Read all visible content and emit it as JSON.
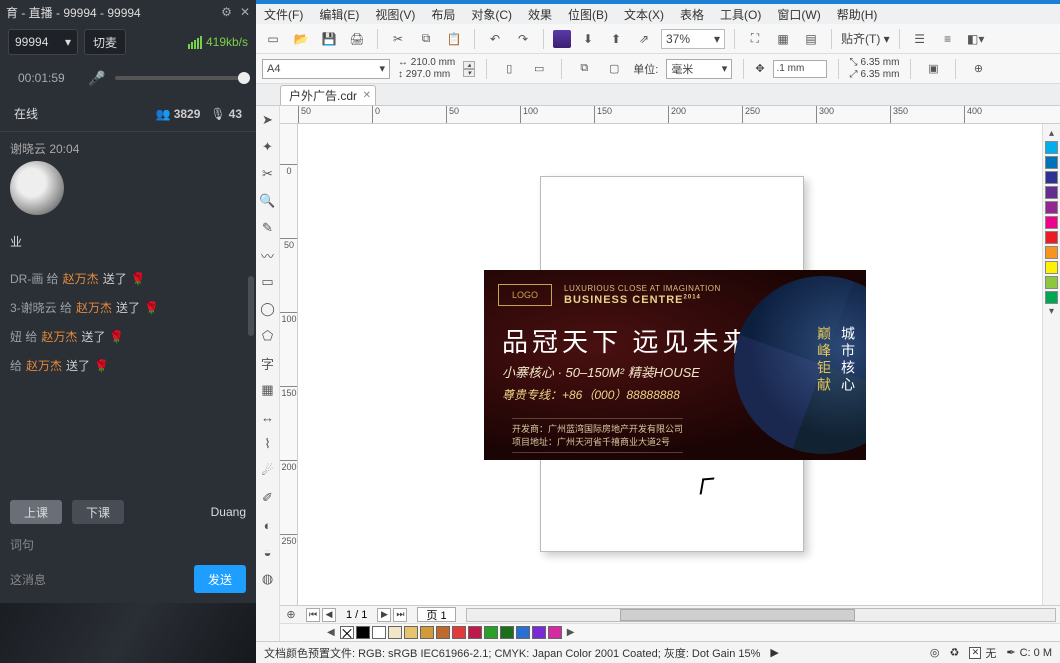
{
  "stream": {
    "title": "育 - 直播 - 99994 - 99994",
    "room_id": "99994",
    "switch_mic": "切麦",
    "bitrate": "419kb/s",
    "elapsed": "00:01:59",
    "tab_online": "在线",
    "viewers": "3829",
    "mics": "43",
    "chat_user": "谢晓云 20:04",
    "biz_label": "业",
    "gifts": [
      {
        "prefix": "DR-画 给",
        "name": "赵万杰",
        "verb": "送了"
      },
      {
        "prefix": "3-谢晓云 给",
        "name": "赵万杰",
        "verb": "送了"
      },
      {
        "prefix": "妞 给",
        "name": "赵万杰",
        "verb": "送了"
      },
      {
        "prefix": "给",
        "name": "赵万杰",
        "verb": "送了"
      }
    ],
    "btn_start": "上课",
    "btn_end": "下课",
    "btn_duang": "Duang",
    "keyword": "词句",
    "input_placeholder": "这消息",
    "send": "发送"
  },
  "menus": [
    "文件(F)",
    "编辑(E)",
    "视图(V)",
    "布局",
    "对象(C)",
    "效果",
    "位图(B)",
    "文本(X)",
    "表格",
    "工具(O)",
    "窗口(W)",
    "帮助(H)"
  ],
  "toolbar": {
    "zoom": "37%",
    "snap_label": "贴齐(T) ▾"
  },
  "propbar": {
    "page_preset": "A4",
    "width_label": "↔ 210.0 mm",
    "height_label": "↕ 297.0 mm",
    "unit_label": "单位:",
    "unit_value": "毫米",
    "nudge": ".1 mm",
    "dup_x": "6.35 mm",
    "dup_y": "6.35 mm"
  },
  "file_tab": "户外广告.cdr",
  "ruler_h": [
    "50",
    "0",
    "50",
    "100",
    "150",
    "200",
    "250",
    "300",
    "350",
    "400"
  ],
  "ruler_v": [
    "0",
    "50",
    "100",
    "150",
    "200",
    "250"
  ],
  "artwork": {
    "eng1": "LUXURIOUS CLOSE AT IMAGINATION",
    "eng2": "BUSINESS CENTRE",
    "headline": "品冠天下 远见未来",
    "sub": "小寨核心 · 50–150M² 精装HOUSE",
    "tel": "尊贵专线：+86（000）88888888",
    "info1": "开发商：广州蓝湾国际房地产开发有限公司",
    "info2": "项目地址：广州天河省千禧商业大道2号",
    "vert_a": "巅峰钜献",
    "vert_b": "城市核心"
  },
  "pager": {
    "count": "1 / 1",
    "tab": "页 1"
  },
  "palette_h_colors": [
    "#000000",
    "#ffffff",
    "#f2e6c8",
    "#e6c46e",
    "#d49a3a",
    "#bf6a2a",
    "#e23a3a",
    "#bf1a4a",
    "#2a9f2a",
    "#1a6f1a",
    "#2a6fd4",
    "#7a2ad4",
    "#d42aa4",
    "#3a3a3a"
  ],
  "palette_v_colors": [
    "#00aeef",
    "#0072bc",
    "#2e3192",
    "#662d91",
    "#92278f",
    "#ec008c",
    "#ed1c24",
    "#f7941d",
    "#fff200",
    "#8dc63f",
    "#00a651"
  ],
  "status": {
    "profiles": "文档颜色预置文件: RGB: sRGB IEC61966-2.1; CMYK: Japan Color 2001 Coated; 灰度: Dot Gain 15%",
    "fill_none": "无",
    "outline": "C: 0 M"
  }
}
